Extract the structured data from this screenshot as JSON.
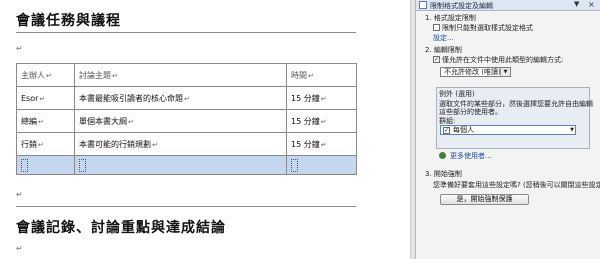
{
  "document": {
    "heading1": "會議任務與議程",
    "heading2": "會議記錄、討論重點與達成結論",
    "paragraph_mark": "↵",
    "table": {
      "headers": [
        "主辦人",
        "討論主題",
        "時間"
      ],
      "rows": [
        [
          "Esor",
          "本書最能吸引讀者的核心命題",
          "15 分鐘"
        ],
        [
          "總編",
          "單個本書大綱",
          "15 分鐘"
        ],
        [
          "行銷",
          "本書可能的行銷規劃",
          "15 分鐘"
        ]
      ]
    }
  },
  "task_pane": {
    "title": "限制格式設定及編輯",
    "section1_title": "1. 格式設定限制",
    "section1_checkbox": "限制只能對選取樣式設定格式",
    "settings_link": "設定...",
    "section2_title": "2. 編輯限制",
    "section2_checkbox": "僅允許在文件中使用此類型的編輯方式:",
    "edit_type_value": "不允許修改 (唯讀)",
    "exceptions_title": "例外 (選用)",
    "exceptions_desc_line1": "選取文件的某些部分，然後選擇您要允許自由編輯",
    "exceptions_desc_line2": "這些部分的使用者。",
    "groups_label": "群組:",
    "group_everyone": "每個人",
    "more_users_link": "更多使用者...",
    "section3_title": "3. 開始強制",
    "section3_question": "您準備好要套用這些設定嗎? (您稍後可以關閉這些設定)",
    "start_button": "是，開始強制保護",
    "checked_mark": "✓"
  }
}
